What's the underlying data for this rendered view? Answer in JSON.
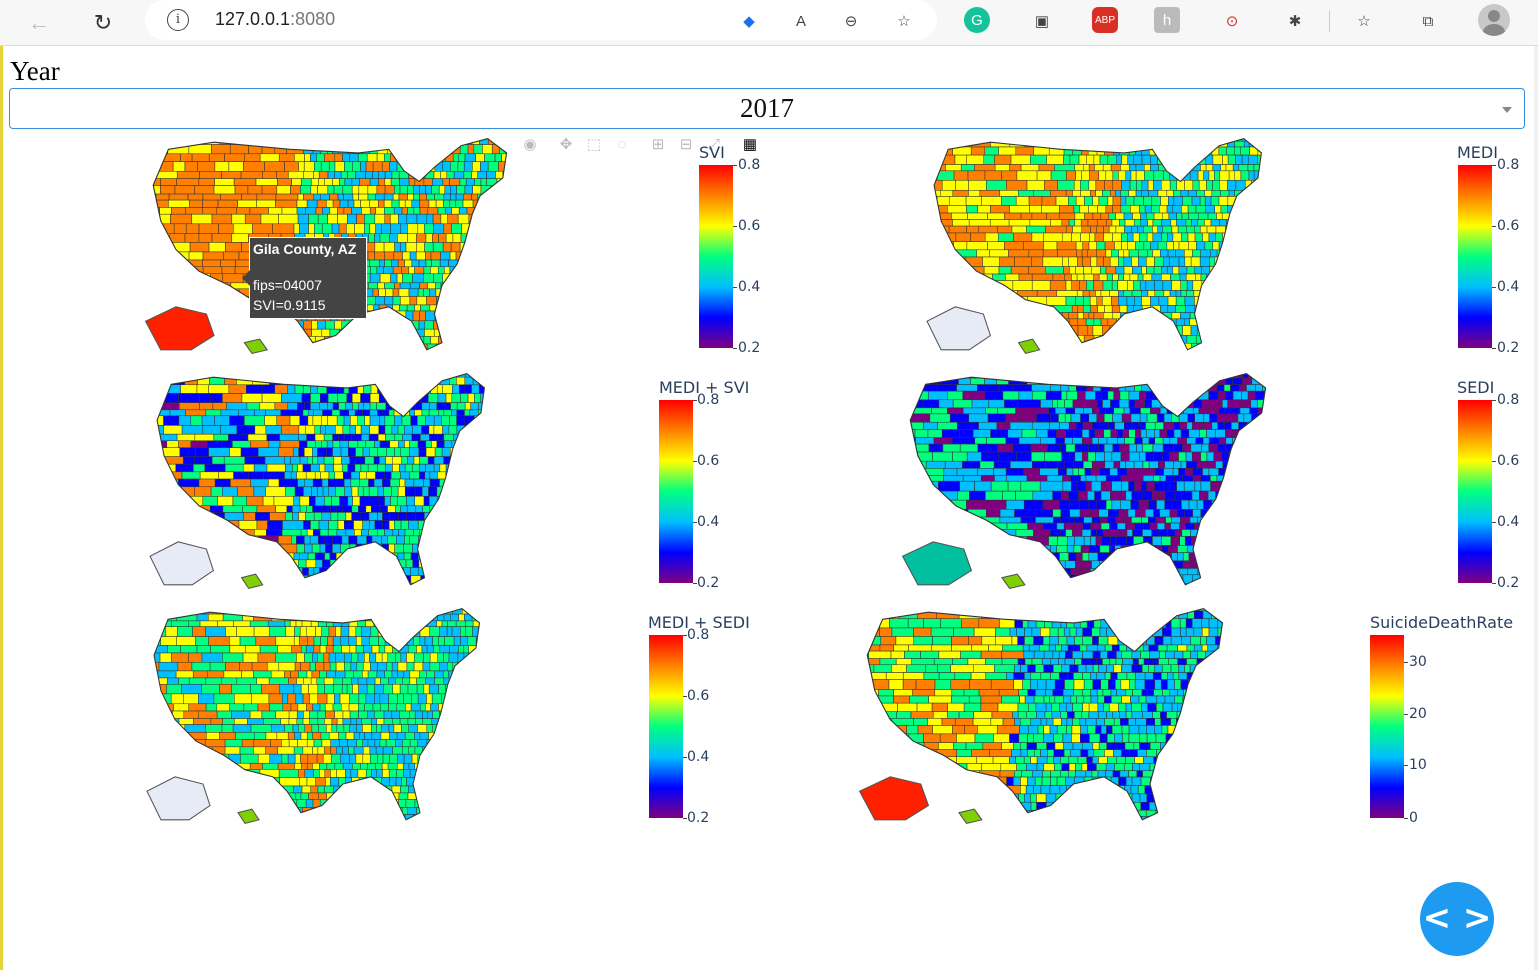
{
  "browser": {
    "url_host": "127.0.0.1",
    "url_port": ":8080",
    "info_glyph": "i"
  },
  "year_label": "Year",
  "year_select": {
    "value": "2017"
  },
  "tooltip": {
    "title": "Gila County, AZ",
    "line1": "fips=04007",
    "line2": "SVI=0.9115"
  },
  "panels": [
    {
      "id": "svi",
      "title": "SVI",
      "ticks": [
        "0.8",
        "0.6",
        "0.4",
        "0.2"
      ]
    },
    {
      "id": "medi",
      "title": "MEDI",
      "ticks": [
        "0.8",
        "0.6",
        "0.4",
        "0.2"
      ]
    },
    {
      "id": "medi-svi",
      "title": "MEDI + SVI",
      "ticks": [
        "0.8",
        "0.6",
        "0.4",
        "0.2"
      ]
    },
    {
      "id": "sedi",
      "title": "SEDI",
      "ticks": [
        "0.8",
        "0.6",
        "0.4",
        "0.2"
      ]
    },
    {
      "id": "medi-sedi",
      "title": "MEDI + SEDI",
      "ticks": [
        "0.8",
        "0.6",
        "0.4",
        "0.2"
      ]
    },
    {
      "id": "suicide",
      "title": "SuicideDeathRate",
      "ticks": [
        "30",
        "20",
        "10",
        "0"
      ]
    }
  ],
  "colorscale": [
    "#800080",
    "#0000ff",
    "#00bfff",
    "#00ff80",
    "#ffff00",
    "#ff8000",
    "#ff0000"
  ],
  "fab_label": "< >"
}
